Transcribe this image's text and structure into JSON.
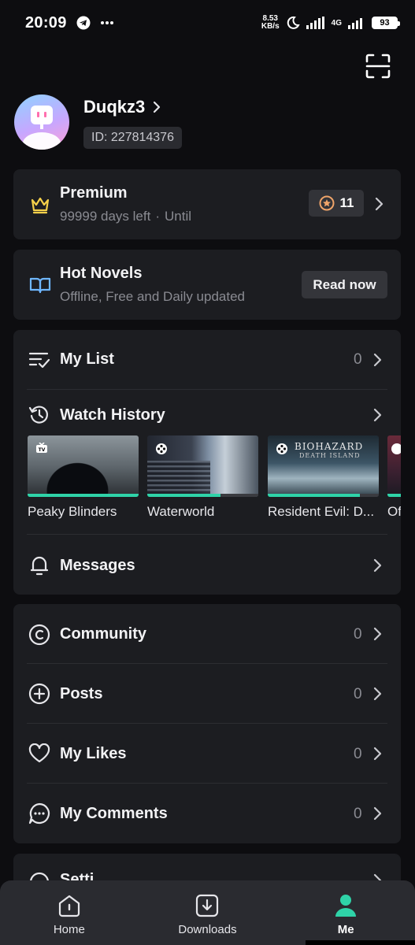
{
  "status_bar": {
    "time": "20:09",
    "netspeed_value": "8.53",
    "netspeed_unit": "KB/s",
    "network": "4G",
    "battery": "93"
  },
  "profile": {
    "username": "Duqkz3",
    "user_id": "ID: 227814376"
  },
  "premium": {
    "title": "Premium",
    "days_left": "99999 days left",
    "separator": "·",
    "until": "Until",
    "coins": "11"
  },
  "novels": {
    "title": "Hot Novels",
    "subtitle": "Offline, Free and Daily updated",
    "button": "Read now"
  },
  "list_section": {
    "my_list": {
      "label": "My List",
      "count": "0"
    },
    "watch_history": {
      "label": "Watch History"
    },
    "messages": {
      "label": "Messages"
    },
    "history_items": [
      {
        "title": "Peaky Blinders",
        "badge": "tv-icon",
        "progress": 1.0
      },
      {
        "title": "Waterworld",
        "badge": "film-reel-icon",
        "progress": 0.66
      },
      {
        "title": "Resident Evil: D...",
        "badge": "film-reel-icon",
        "progress": 0.83,
        "poster_title": "BIOHAZARD",
        "poster_subtitle": "DEATH ISLAND"
      },
      {
        "title": "Of",
        "badge": "film-reel-icon",
        "progress": 1.0
      }
    ]
  },
  "community_section": {
    "community": {
      "label": "Community",
      "count": "0"
    },
    "posts": {
      "label": "Posts",
      "count": "0"
    },
    "likes": {
      "label": "My Likes",
      "count": "0"
    },
    "comments": {
      "label": "My Comments",
      "count": "0"
    }
  },
  "settings": {
    "label": "Setti"
  },
  "bottom_nav": {
    "home": "Home",
    "downloads": "Downloads",
    "me": "Me"
  },
  "colors": {
    "accent": "#2fd3a8",
    "background": "#0d0d10",
    "card": "#1c1d21",
    "premium_crown": "#f5d04a",
    "novel_icon": "#6fb7ff"
  }
}
